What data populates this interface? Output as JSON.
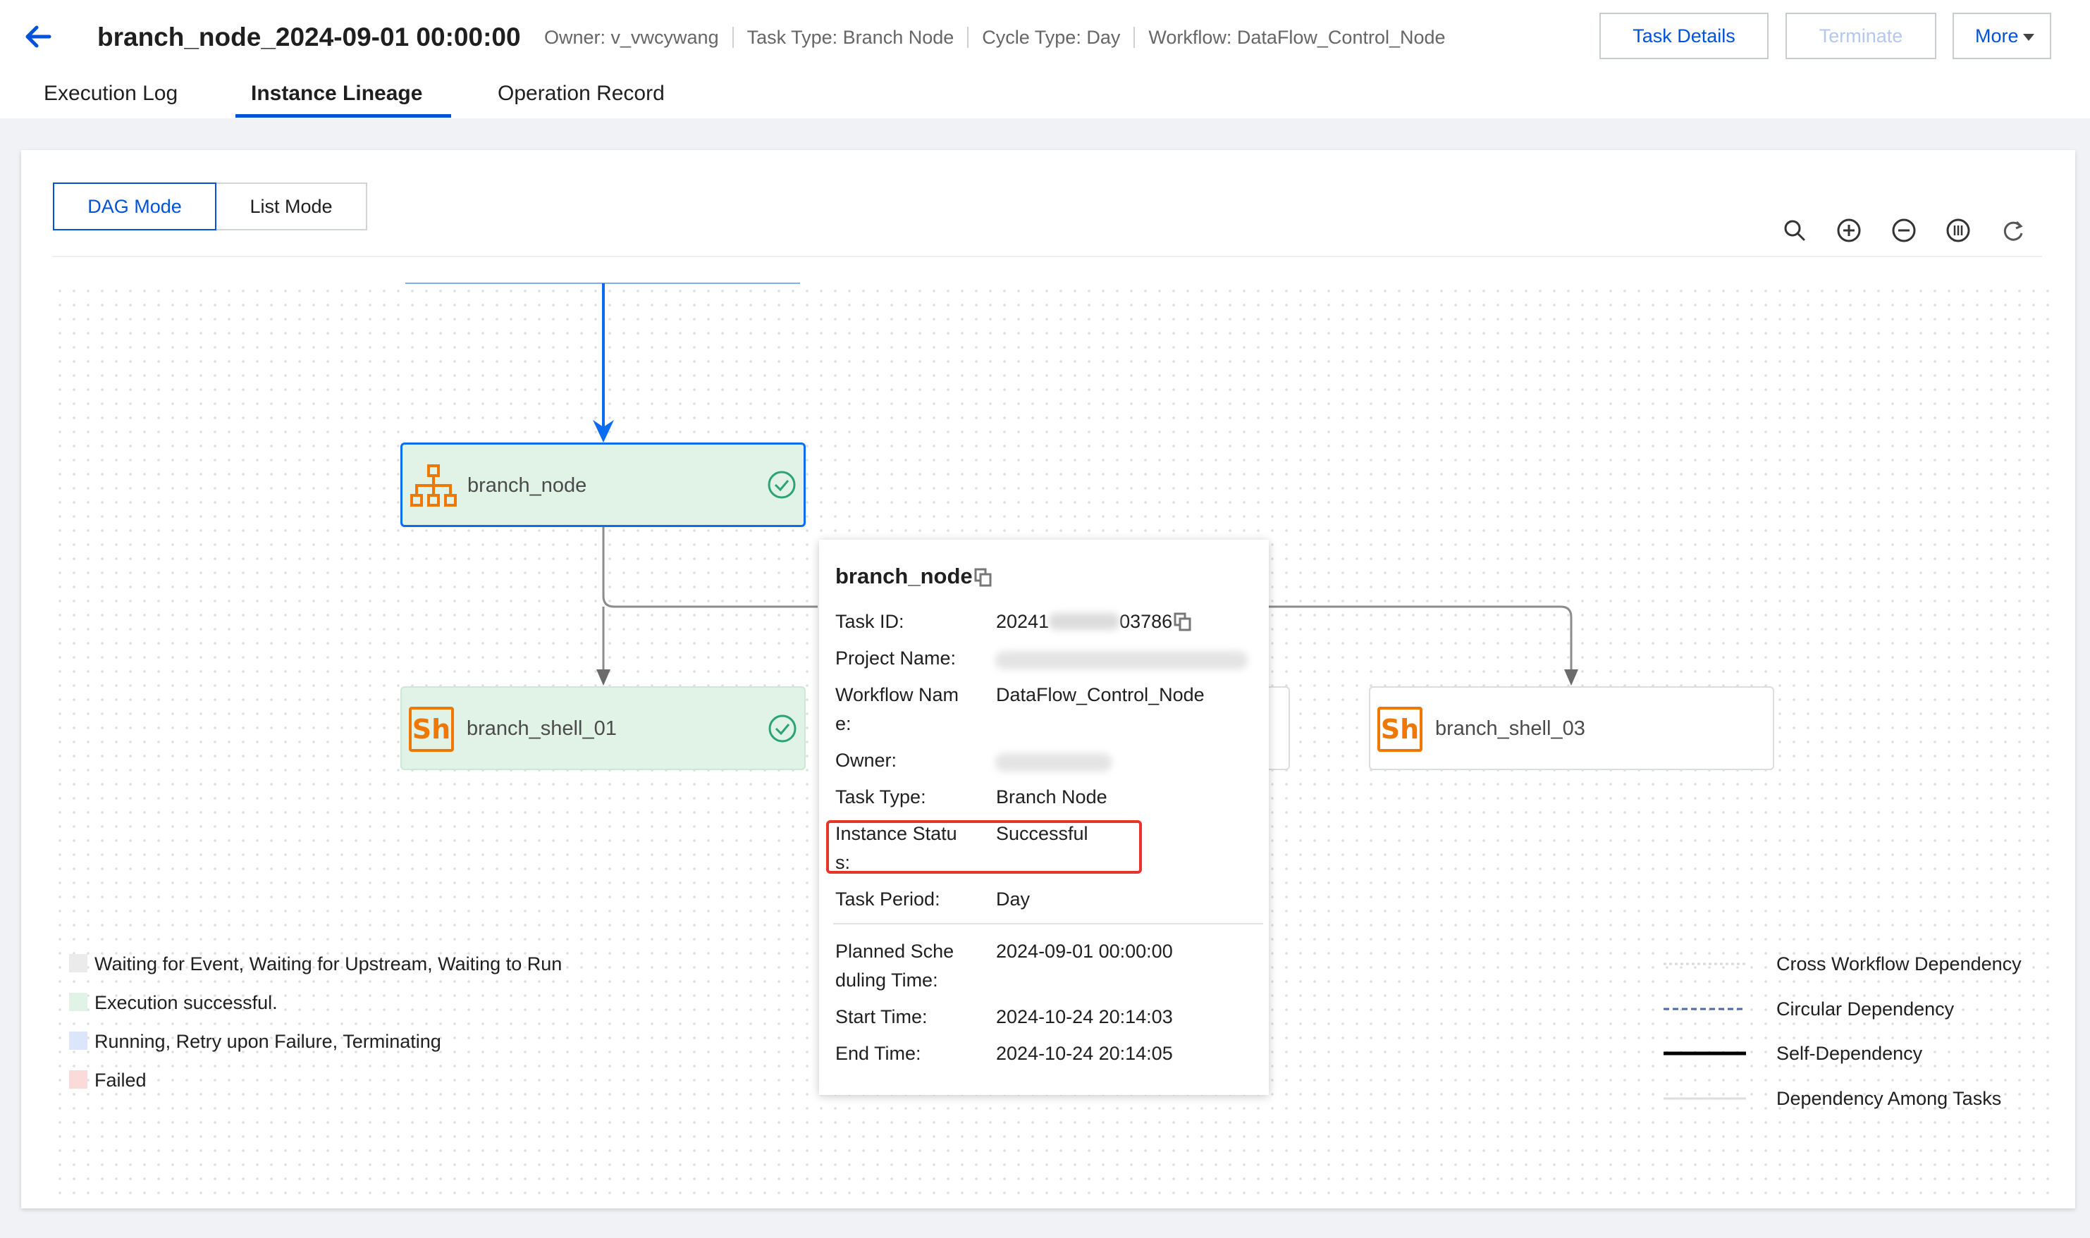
{
  "header": {
    "title": "branch_node_2024-09-01 00:00:00",
    "owner": "Owner: v_vwcywang",
    "task_type": "Task Type: Branch Node",
    "cycle_type": "Cycle Type: Day",
    "workflow": "Workflow: DataFlow_Control_Node",
    "buttons": {
      "task_details": "Task Details",
      "terminate": "Terminate",
      "more": "More"
    },
    "tabs": [
      {
        "label": "Execution Log",
        "active": false
      },
      {
        "label": "Instance Lineage",
        "active": true
      },
      {
        "label": "Operation Record",
        "active": false
      }
    ]
  },
  "view_modes": {
    "dag": "DAG Mode",
    "list": "List Mode",
    "selected": "DAG Mode"
  },
  "dag": {
    "nodes": [
      {
        "name": "branch_node",
        "icon": "branch-icon",
        "status": "success"
      },
      {
        "name": "branch_shell_01",
        "icon": "shell-icon",
        "status": "success"
      },
      {
        "name": "branch_shell_03",
        "icon": "shell-icon",
        "status": "none"
      }
    ],
    "shell_icon_text": "Sh",
    "toolbar": [
      "search-icon",
      "zoom-in-icon",
      "zoom-out-icon",
      "fit-view-icon",
      "refresh-icon"
    ]
  },
  "popup": {
    "title": "branch_node",
    "task_id_prefix": "20241",
    "task_id_suffix": "03786",
    "labels": {
      "task_id": "Task ID:",
      "project_name": "Project Name:",
      "workflow_name_1": "Workflow Nam",
      "workflow_name_2": "e:",
      "owner": "Owner:",
      "task_type": "Task Type:",
      "instance_status_1": "Instance Statu",
      "instance_status_2": "s:",
      "task_period": "Task Period:",
      "planned_1": "Planned Sche",
      "planned_2": "duling Time:",
      "start_time": "Start Time:",
      "end_time": "End Time:"
    },
    "values": {
      "workflow_name": "DataFlow_Control_Node",
      "task_type": "Branch Node",
      "instance_status": "Successful",
      "task_period": "Day",
      "planned_time": "2024-09-01 00:00:00",
      "start_time": "2024-10-24 20:14:03",
      "end_time": "2024-10-24 20:14:05"
    }
  },
  "legend_status": [
    {
      "label": "Waiting for Event, Waiting for Upstream, Waiting to Run",
      "color": "#ebebeb"
    },
    {
      "label": "Execution successful.",
      "color": "#e0f3e6"
    },
    {
      "label": "Running, Retry upon Failure, Terminating",
      "color": "#dbe6fb"
    },
    {
      "label": "Failed",
      "color": "#fbdada"
    }
  ],
  "legend_lines": [
    {
      "label": "Cross Workflow Dependency",
      "style": "dotted-light"
    },
    {
      "label": "Circular Dependency",
      "style": "dashed-blue"
    },
    {
      "label": "Self-Dependency",
      "style": "solid-black"
    },
    {
      "label": "Dependency Among Tasks",
      "style": "solid-light"
    }
  ],
  "colors": {
    "accent": "#0052d9",
    "success_fill": "#e0f3e6",
    "success_check": "#2ba471",
    "icon_orange": "#f07800",
    "highlight": "#e8342a"
  }
}
